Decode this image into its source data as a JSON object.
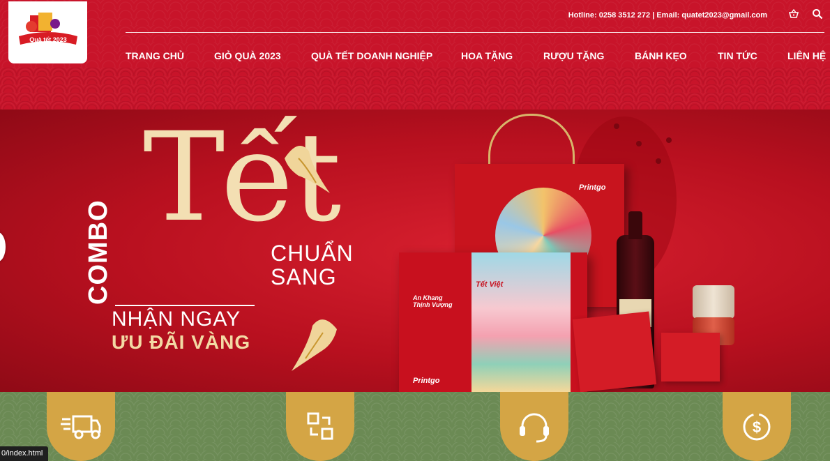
{
  "header": {
    "logo_text": "Quà tết 2023",
    "contact": "Hotline: 0258 3512 272 | Email: quatet2023@gmail.com",
    "icons": [
      "basket-icon",
      "search-icon"
    ],
    "nav": [
      "TRANG CHỦ",
      "GIỎ QUÀ 2023",
      "QUÀ TẾT DOANH NGHIỆP",
      "HOA TẶNG",
      "RƯỢU TẶNG",
      "BÁNH KẸO",
      "TIN TỨC",
      "LIÊN HỆ"
    ]
  },
  "banner": {
    "combo": "COMBO",
    "tet": "Tết",
    "chuan": "CHUẨN",
    "sang": "SANG",
    "nhan_ngay": "NHẬN NGAY",
    "uu_dai": "ƯU ĐÃI VÀNG",
    "box_brand": "Printgo",
    "box_title": "Tết Việt",
    "box_sub": "An Khang Thịnh Vượng"
  },
  "features": [
    {
      "icon": "delivery-truck-icon"
    },
    {
      "icon": "exchange-icon"
    },
    {
      "icon": "headset-support-icon"
    },
    {
      "icon": "money-refund-icon"
    }
  ],
  "status_bar": "0/index.html",
  "colors": {
    "header_red": "#c8142a",
    "banner_red": "#c8101e",
    "gold": "#d4a545",
    "green_strip": "#6b8a54",
    "cream_text": "#f3dfb3"
  }
}
